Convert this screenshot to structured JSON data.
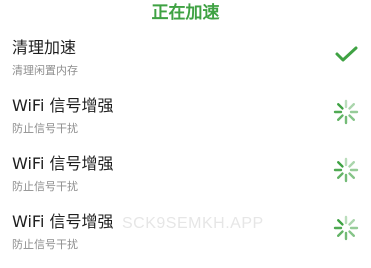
{
  "header": {
    "title": "正在加速"
  },
  "colors": {
    "accent": "#3fa243",
    "label": "#1e1e1e",
    "sublabel": "#8e8e8e"
  },
  "items": [
    {
      "label": "清理加速",
      "sublabel": "清理闲置内存",
      "status": "done",
      "icon": "checkmark-icon"
    },
    {
      "label": "WiFi 信号增强",
      "sublabel": "防止信号干扰",
      "status": "loading",
      "icon": "spinner-icon"
    },
    {
      "label": "WiFi 信号增强",
      "sublabel": "防止信号干扰",
      "status": "loading",
      "icon": "spinner-icon"
    },
    {
      "label": "WiFi 信号增强",
      "sublabel": "防止信号干扰",
      "status": "loading",
      "icon": "spinner-icon"
    }
  ],
  "watermark": "SCK9SEMKH.APP"
}
